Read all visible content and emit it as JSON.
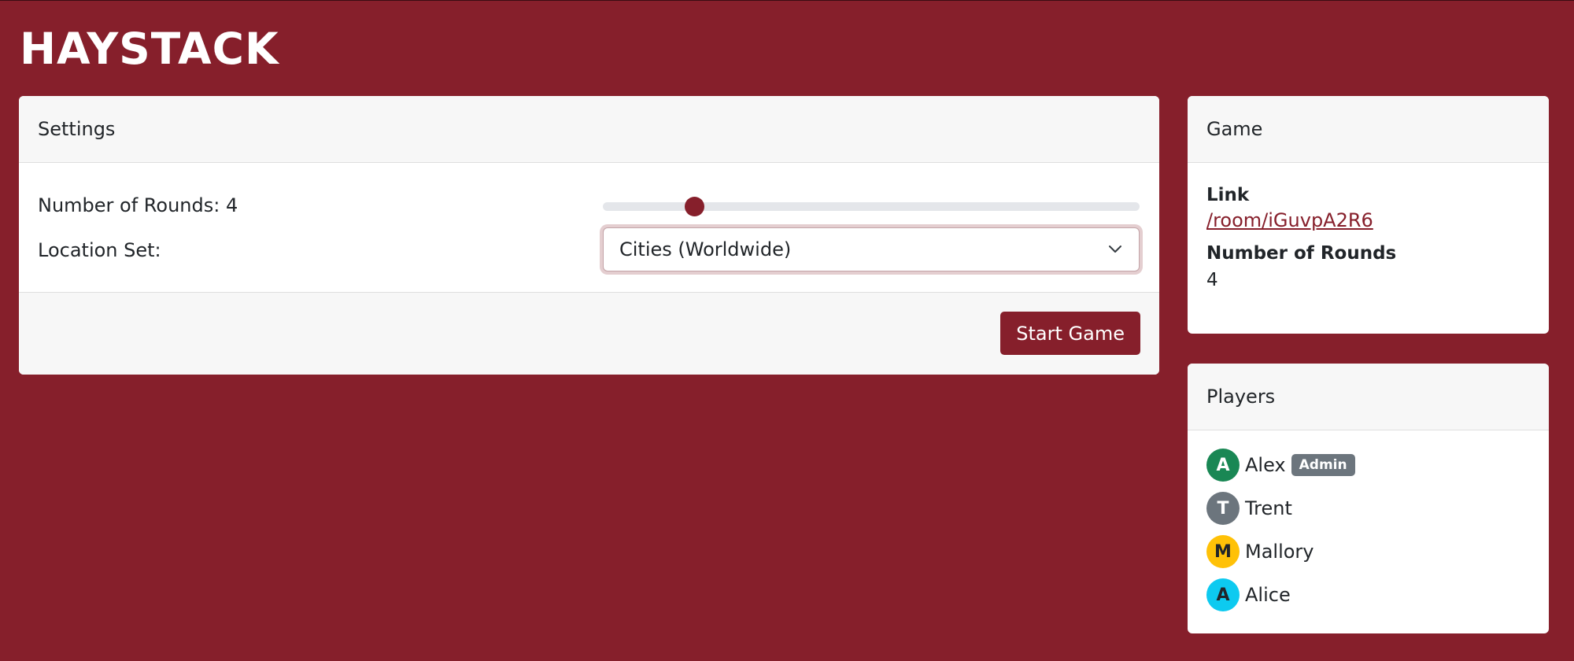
{
  "app": {
    "title": "HAYSTACK"
  },
  "settings": {
    "header": "Settings",
    "rounds_label": "Number of Rounds: 4",
    "rounds_slider": {
      "value": 4,
      "min": 1,
      "max": 20
    },
    "location_label": "Location Set:",
    "location_selected": "Cities (Worldwide)",
    "start_button": "Start Game"
  },
  "game": {
    "header": "Game",
    "link_label": "Link",
    "link_value": "/room/iGuvpA2R6",
    "rounds_label": "Number of Rounds",
    "rounds_value": "4"
  },
  "players": {
    "header": "Players",
    "badge_admin": "Admin",
    "list": [
      {
        "initial": "A",
        "name": "Alex",
        "color": "#198754",
        "text_color": "#ffffff",
        "admin": true
      },
      {
        "initial": "T",
        "name": "Trent",
        "color": "#6c757d",
        "text_color": "#ffffff",
        "admin": false
      },
      {
        "initial": "M",
        "name": "Mallory",
        "color": "#ffc107",
        "text_color": "#212529",
        "admin": false
      },
      {
        "initial": "A",
        "name": "Alice",
        "color": "#0dcaf0",
        "text_color": "#212529",
        "admin": false
      }
    ]
  },
  "colors": {
    "brand": "#861f2b",
    "badge_gray": "#6c757d"
  }
}
